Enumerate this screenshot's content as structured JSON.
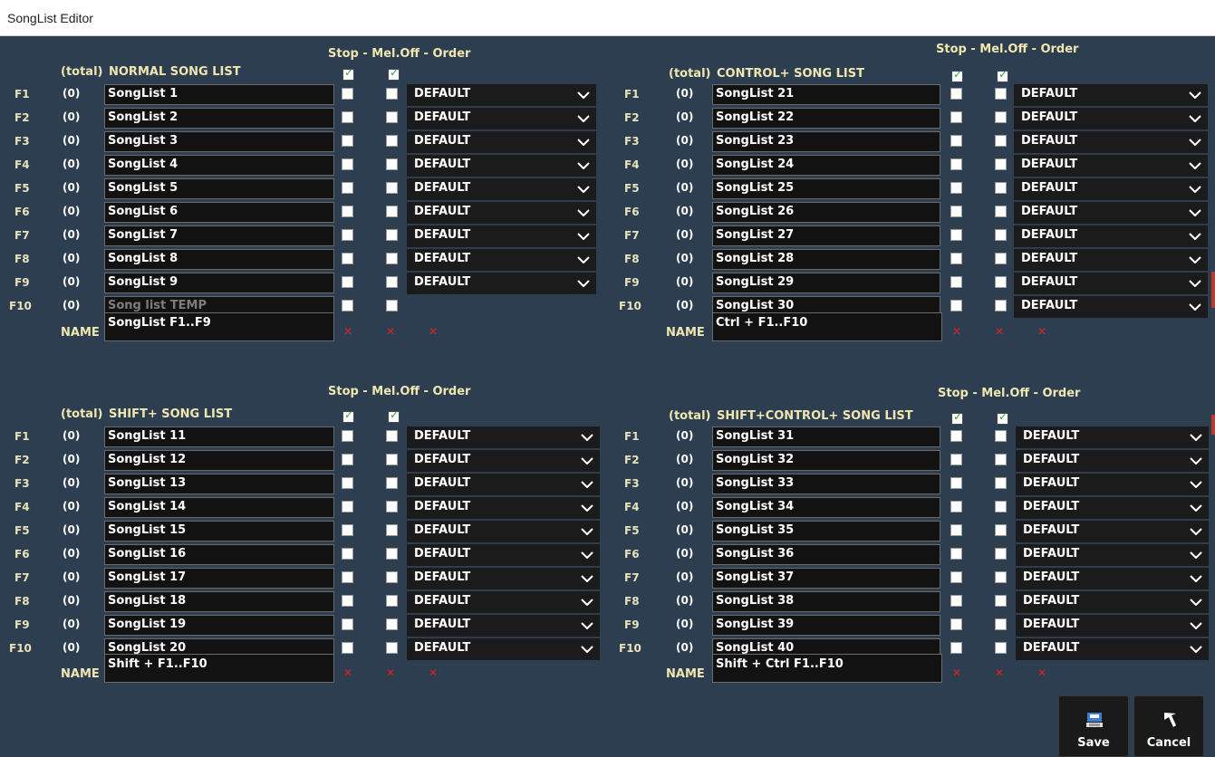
{
  "window": {
    "title": "SongList Editor"
  },
  "labels": {
    "column_header": "Stop - Mel.Off - Order",
    "total": "(total)",
    "name": "NAME",
    "count": "(0)",
    "order_value": "DEFAULT",
    "fkeys": [
      "F1",
      "F2",
      "F3",
      "F4",
      "F5",
      "F6",
      "F7",
      "F8",
      "F9",
      "F10"
    ]
  },
  "panels": [
    {
      "title": "NORMAL SONG LIST",
      "songs": [
        "SongList 1",
        "SongList 2",
        "SongList 3",
        "SongList 4",
        "SongList 5",
        "SongList 6",
        "SongList 7",
        "SongList 8",
        "SongList 9",
        "Song list TEMP"
      ],
      "name_value": "SongList F1..F9"
    },
    {
      "title": "CONTROL+  SONG LIST",
      "songs": [
        "SongList 21",
        "SongList 22",
        "SongList 23",
        "SongList 24",
        "SongList 25",
        "SongList 26",
        "SongList 27",
        "SongList 28",
        "SongList 29",
        "SongList 30"
      ],
      "name_value": "Ctrl + F1..F10"
    },
    {
      "title": "SHIFT+  SONG LIST",
      "songs": [
        "SongList 11",
        "SongList 12",
        "SongList 13",
        "SongList 14",
        "SongList 15",
        "SongList 16",
        "SongList 17",
        "SongList 18",
        "SongList 19",
        "SongList 20"
      ],
      "name_value": "Shift + F1..F10"
    },
    {
      "title": "SHIFT+CONTROL+  SONG LIST",
      "songs": [
        "SongList 31",
        "SongList 32",
        "SongList 33",
        "SongList 34",
        "SongList 35",
        "SongList 36",
        "SongList 37",
        "SongList 38",
        "SongList 39",
        "SongList 40"
      ],
      "name_value": "Shift + Ctrl F1..F10"
    }
  ],
  "buttons": {
    "save": "Save",
    "cancel": "Cancel"
  },
  "colors": {
    "background": "#2c3e4f",
    "header_text": "#f0e6b0",
    "field_bg": "#121212",
    "delete_mark": "#e02020"
  }
}
